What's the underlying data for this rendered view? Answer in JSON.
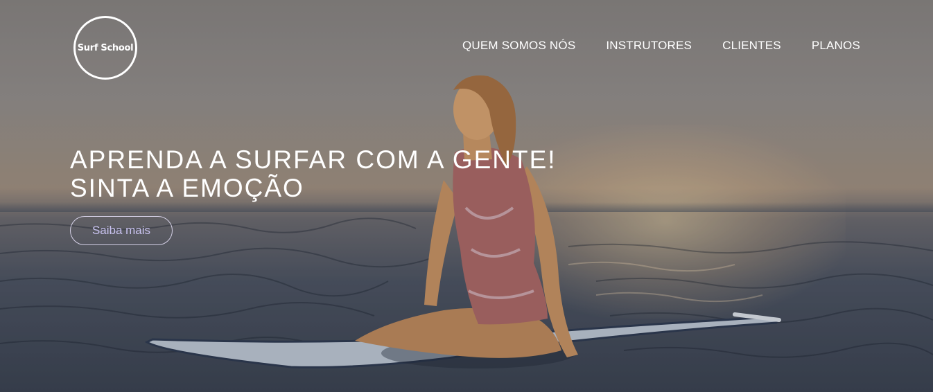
{
  "brand": {
    "logo_text": "Surf School"
  },
  "nav": {
    "items": [
      {
        "label": "QUEM SOMOS NÓS"
      },
      {
        "label": "INSTRUTORES"
      },
      {
        "label": "CLIENTES"
      },
      {
        "label": "PLANOS"
      }
    ]
  },
  "hero": {
    "headline_line1": "APRENDA A SURFAR COM A GENTE!",
    "headline_line2": "SINTA A EMOÇÃO",
    "cta_label": "Saiba mais"
  },
  "colors": {
    "text": "#ffffff",
    "cta_text": "#c9c3f0",
    "cta_border": "#ebe6ff"
  }
}
